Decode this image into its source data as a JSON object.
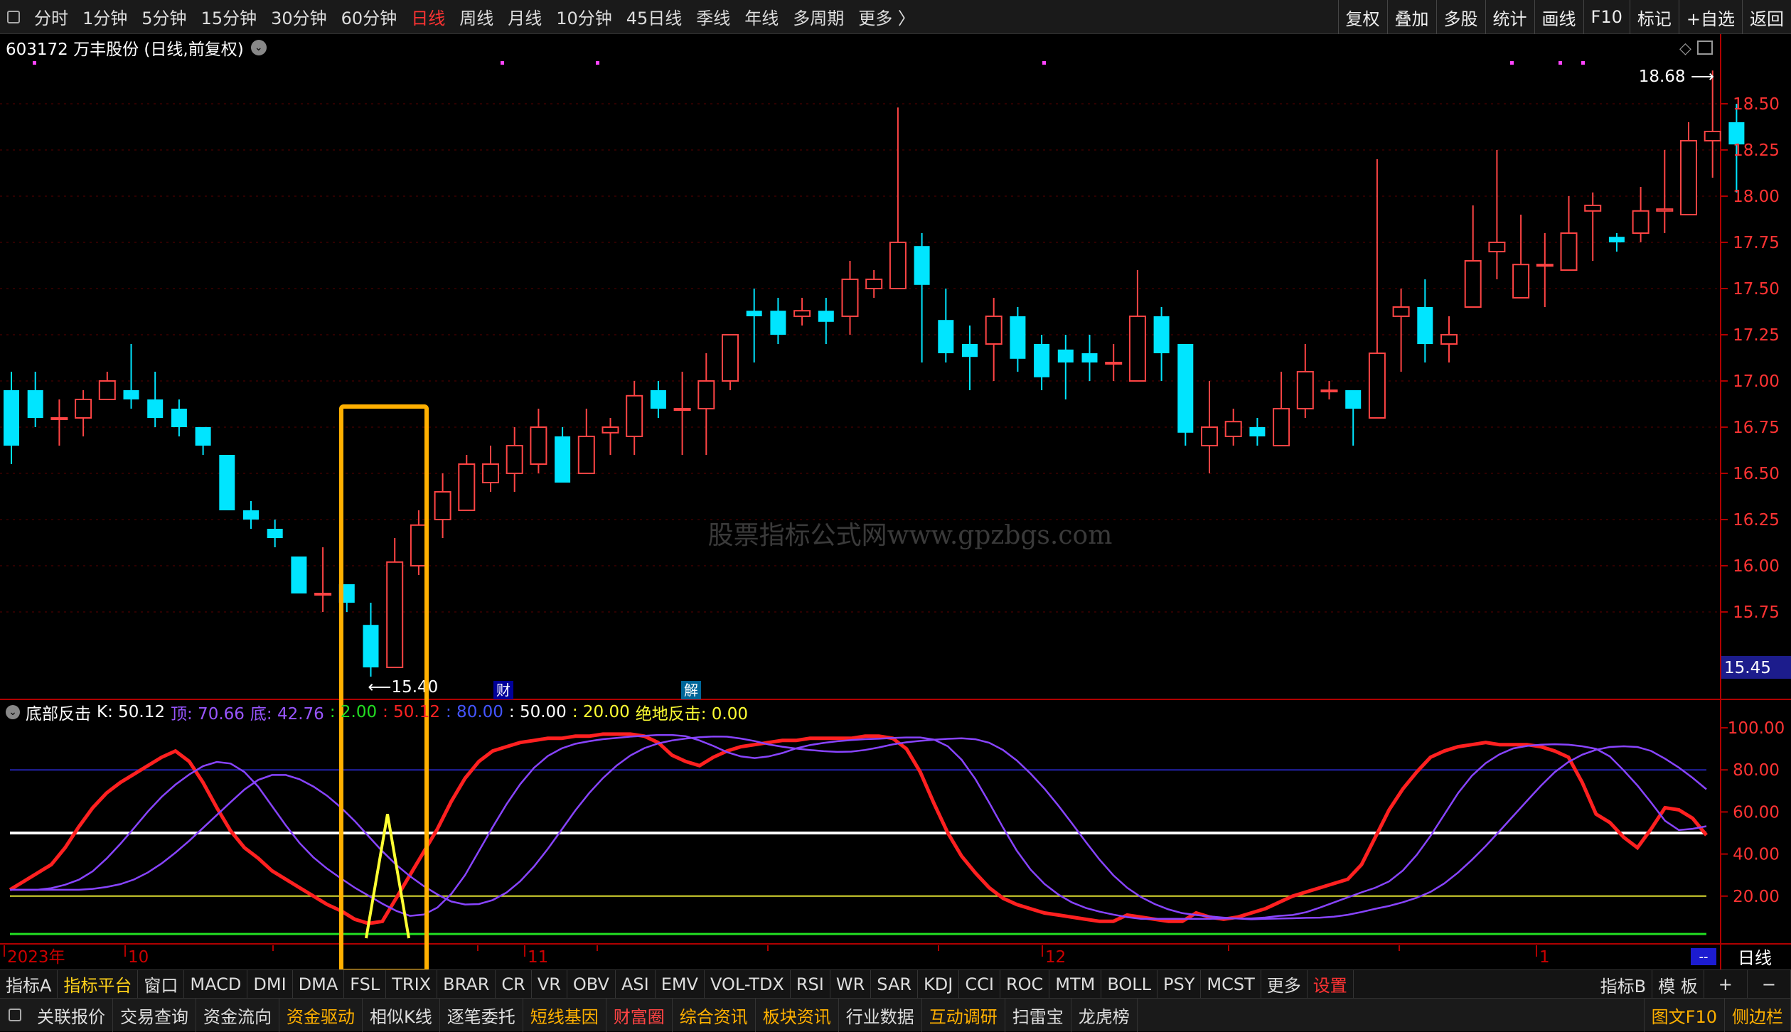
{
  "topbar": {
    "periods": [
      "分时",
      "1分钟",
      "5分钟",
      "15分钟",
      "30分钟",
      "60分钟",
      "日线",
      "周线",
      "月线",
      "10分钟",
      "45日线",
      "季线",
      "年线",
      "多周期",
      "更多 〉"
    ],
    "active_index": 6,
    "tools": [
      "复权",
      "叠加",
      "多股",
      "统计",
      "画线",
      "F10",
      "标记",
      "+自选",
      "返回"
    ]
  },
  "stock": {
    "title": "603172 万丰股份 (日线,前复权)"
  },
  "indicator": {
    "name": "底部反击",
    "k_label": "K: 50.12",
    "top_label": "顶: 70.66",
    "bottom_label": "底: 42.76",
    "l1": ": 2.00",
    "l2": ": 50.12",
    "l3": ": 80.00",
    "l4": ": 50.00",
    "l5": ": 20.00",
    "jd_label": "绝地反击: 0.00"
  },
  "tabs": [
    "指标A",
    "指标平台",
    "窗口",
    "MACD",
    "DMI",
    "DMA",
    "FSL",
    "TRIX",
    "BRAR",
    "CR",
    "VR",
    "OBV",
    "ASI",
    "EMV",
    "VOL-TDX",
    "RSI",
    "WR",
    "SAR",
    "KDJ",
    "CCI",
    "ROC",
    "MTM",
    "BOLL",
    "PSY",
    "MCST",
    "更多",
    "设置"
  ],
  "tabs_right": [
    "指标B",
    "模 板",
    "+",
    "−"
  ],
  "bottom": [
    "关联报价",
    "交易查询",
    "资金流向",
    "资金驱动",
    "相似K线",
    "逐笔委托",
    "短线基因",
    "财富圈",
    "综合资讯",
    "板块资讯",
    "行业数据",
    "互动调研",
    "扫雷宝",
    "龙虎榜"
  ],
  "bottom_right": [
    "图文F10",
    "侧边栏"
  ],
  "colors": {
    "up": "#ff4444",
    "down": "#00e5ff",
    "k_line": "#ff2020",
    "purple": "#8844ff",
    "yellow": "#ffff33",
    "box": "#ffb000",
    "axis_red": "#cc0000"
  },
  "chart_data": {
    "type": "candlestick",
    "watermark": "股票指标公式网www.gpzbgs.com",
    "price_ticks": [
      18.5,
      18.25,
      18.0,
      17.75,
      17.5,
      17.25,
      17.0,
      16.75,
      16.5,
      16.25,
      16.0,
      15.75
    ],
    "current_price": "15.45",
    "high_label": "18.68",
    "low_label": "15.40",
    "x_labels": [
      "2023年",
      "10",
      "11",
      "12",
      "1"
    ],
    "period_label": "日线",
    "markers": [
      "财",
      "解"
    ],
    "ind_ticks": [
      "100.00",
      "80.00",
      "60.00",
      "40.00",
      "20.00"
    ],
    "candles": [
      [
        16.95,
        16.65,
        17.05,
        16.55
      ],
      [
        16.95,
        16.8,
        17.05,
        16.75
      ],
      [
        16.8,
        16.8,
        16.9,
        16.65
      ],
      [
        16.8,
        16.9,
        16.95,
        16.7
      ],
      [
        16.9,
        17.0,
        17.05,
        16.9
      ],
      [
        16.95,
        16.9,
        17.2,
        16.85
      ],
      [
        16.9,
        16.8,
        17.05,
        16.75
      ],
      [
        16.85,
        16.75,
        16.9,
        16.7
      ],
      [
        16.75,
        16.65,
        16.75,
        16.6
      ],
      [
        16.6,
        16.3,
        16.6,
        16.3
      ],
      [
        16.3,
        16.25,
        16.35,
        16.2
      ],
      [
        16.2,
        16.15,
        16.25,
        16.1
      ],
      [
        16.05,
        15.85,
        16.05,
        15.85
      ],
      [
        15.85,
        15.85,
        16.1,
        15.75
      ],
      [
        15.9,
        15.8,
        15.9,
        15.75
      ],
      [
        15.68,
        15.45,
        15.8,
        15.4
      ],
      [
        15.45,
        16.02,
        16.15,
        15.45
      ],
      [
        16.0,
        16.22,
        16.3,
        15.95
      ],
      [
        16.25,
        16.4,
        16.5,
        16.15
      ],
      [
        16.3,
        16.55,
        16.6,
        16.3
      ],
      [
        16.45,
        16.55,
        16.65,
        16.4
      ],
      [
        16.5,
        16.65,
        16.75,
        16.4
      ],
      [
        16.55,
        16.75,
        16.85,
        16.5
      ],
      [
        16.7,
        16.45,
        16.75,
        16.45
      ],
      [
        16.5,
        16.7,
        16.85,
        16.5
      ],
      [
        16.72,
        16.75,
        16.8,
        16.6
      ],
      [
        16.7,
        16.92,
        17.0,
        16.6
      ],
      [
        16.95,
        16.85,
        17.0,
        16.8
      ],
      [
        16.85,
        16.85,
        17.05,
        16.6
      ],
      [
        16.85,
        17.0,
        17.15,
        16.6
      ],
      [
        17.0,
        17.25,
        17.25,
        16.95
      ],
      [
        17.38,
        17.35,
        17.5,
        17.1
      ],
      [
        17.38,
        17.25,
        17.45,
        17.2
      ],
      [
        17.35,
        17.38,
        17.45,
        17.3
      ],
      [
        17.38,
        17.32,
        17.45,
        17.2
      ],
      [
        17.35,
        17.55,
        17.65,
        17.25
      ],
      [
        17.5,
        17.55,
        17.6,
        17.45
      ],
      [
        17.5,
        17.75,
        18.48,
        17.5
      ],
      [
        17.73,
        17.52,
        17.8,
        17.1
      ],
      [
        17.33,
        17.15,
        17.5,
        17.1
      ],
      [
        17.2,
        17.13,
        17.3,
        16.95
      ],
      [
        17.2,
        17.35,
        17.45,
        17.0
      ],
      [
        17.35,
        17.12,
        17.4,
        17.05
      ],
      [
        17.2,
        17.02,
        17.25,
        16.95
      ],
      [
        17.17,
        17.1,
        17.25,
        16.9
      ],
      [
        17.15,
        17.1,
        17.25,
        17.0
      ],
      [
        17.1,
        17.1,
        17.2,
        17.0
      ],
      [
        17.0,
        17.35,
        17.6,
        17.0
      ],
      [
        17.35,
        17.15,
        17.4,
        17.0
      ],
      [
        17.2,
        16.72,
        17.2,
        16.65
      ],
      [
        16.65,
        16.75,
        17.0,
        16.5
      ],
      [
        16.7,
        16.78,
        16.85,
        16.65
      ],
      [
        16.75,
        16.7,
        16.8,
        16.65
      ],
      [
        16.65,
        16.85,
        17.05,
        16.65
      ],
      [
        16.85,
        17.05,
        17.2,
        16.8
      ],
      [
        16.95,
        16.95,
        17.0,
        16.9
      ],
      [
        16.95,
        16.85,
        16.95,
        16.65
      ],
      [
        16.8,
        17.15,
        18.2,
        16.8
      ],
      [
        17.35,
        17.4,
        17.5,
        17.05
      ],
      [
        17.4,
        17.2,
        17.55,
        17.1
      ],
      [
        17.2,
        17.25,
        17.35,
        17.1
      ],
      [
        17.4,
        17.65,
        17.95,
        17.4
      ],
      [
        17.7,
        17.75,
        18.25,
        17.55
      ],
      [
        17.45,
        17.63,
        17.9,
        17.45
      ],
      [
        17.63,
        17.63,
        17.8,
        17.4
      ],
      [
        17.6,
        17.8,
        18.0,
        17.6
      ],
      [
        17.92,
        17.95,
        18.02,
        17.65
      ],
      [
        17.78,
        17.75,
        17.8,
        17.7
      ],
      [
        17.8,
        17.92,
        18.05,
        17.75
      ],
      [
        17.92,
        17.93,
        18.25,
        17.8
      ],
      [
        17.9,
        18.3,
        18.4,
        17.9
      ],
      [
        18.3,
        18.35,
        18.68,
        18.1
      ],
      [
        18.4,
        18.28,
        18.5,
        18.02
      ]
    ],
    "k_line": [
      23,
      27,
      31,
      35,
      43,
      53,
      62,
      69,
      74,
      78,
      82,
      86,
      89,
      84,
      74,
      62,
      51,
      43,
      38,
      32,
      28,
      24,
      20,
      16,
      13,
      9,
      7,
      8,
      19,
      30,
      41,
      52,
      65,
      76,
      84,
      89,
      91,
      93,
      94,
      95,
      95,
      96,
      96,
      97,
      97,
      97,
      96,
      93,
      87,
      84,
      82,
      86,
      89,
      91,
      92,
      93,
      94,
      94,
      95,
      95,
      95,
      95,
      96,
      96,
      95,
      90,
      79,
      64,
      50,
      39,
      31,
      24,
      19,
      16,
      14,
      12,
      11,
      10,
      9,
      8,
      8,
      11,
      10,
      9,
      8,
      8,
      12,
      10,
      9,
      10,
      12,
      14,
      17,
      20,
      22,
      24,
      26,
      28,
      35,
      48,
      61,
      71,
      79,
      86,
      89,
      91,
      92,
      93,
      92,
      92,
      92,
      91,
      89,
      86,
      74,
      59,
      55,
      48,
      43,
      52,
      62,
      61,
      57,
      49
    ]
  }
}
